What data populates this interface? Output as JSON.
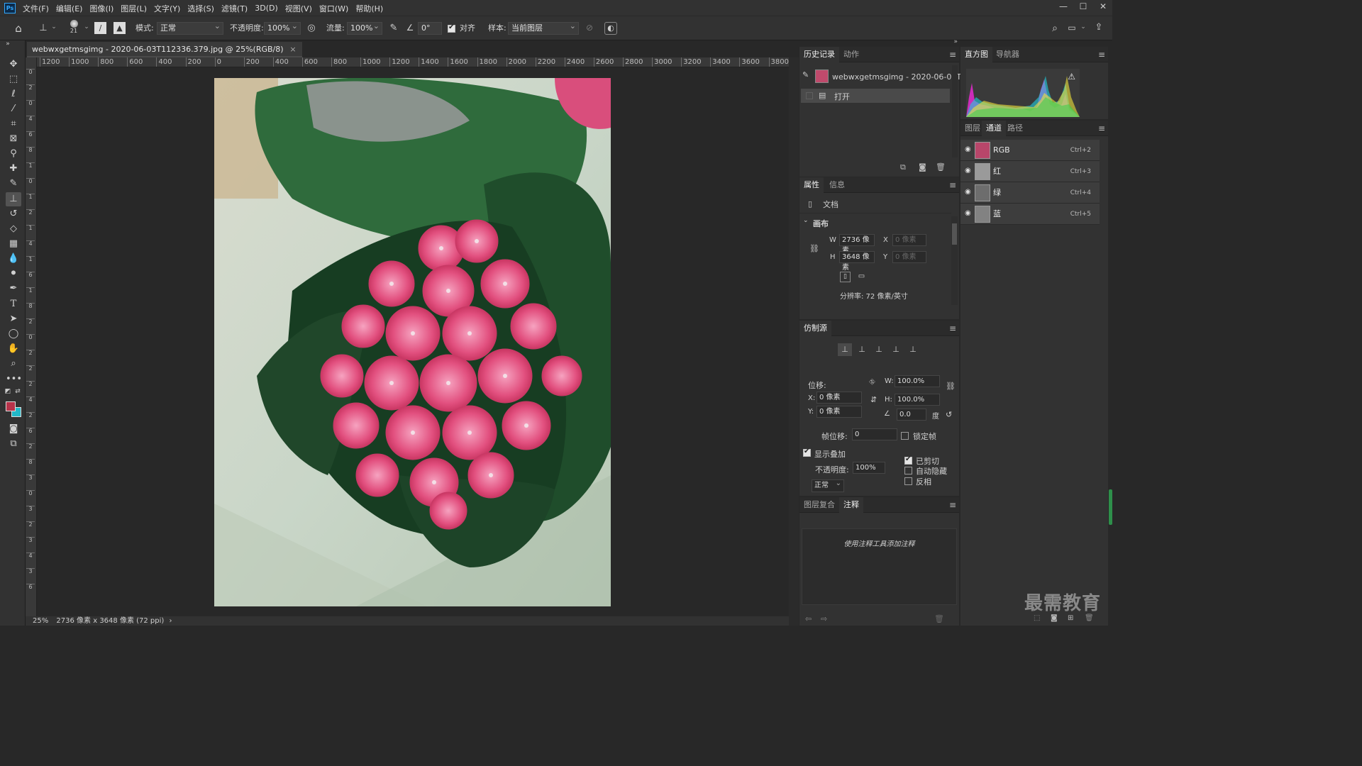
{
  "app": {
    "logo": "Ps"
  },
  "menu": [
    "文件(F)",
    "编辑(E)",
    "图像(I)",
    "图层(L)",
    "文字(Y)",
    "选择(S)",
    "滤镜(T)",
    "3D(D)",
    "视图(V)",
    "窗口(W)",
    "帮助(H)"
  ],
  "window_controls": {
    "minimize": "—",
    "maximize": "☐",
    "close": "✕"
  },
  "options": {
    "brush_size": "21",
    "mode_label": "模式:",
    "mode_value": "正常",
    "opacity_label": "不透明度:",
    "opacity_value": "100%",
    "flow_label": "流量:",
    "flow_value": "100%",
    "angle_value": "0°",
    "aligned_label": "对齐",
    "sample_label": "样本:",
    "sample_value": "当前图层"
  },
  "document": {
    "tab_title": "webwxgetmsgimg - 2020-06-03T112336.379.jpg @ 25%(RGB/8)",
    "tab_close": "×"
  },
  "ruler_h": [
    "1200",
    "1000",
    "800",
    "600",
    "400",
    "200",
    "0",
    "200",
    "400",
    "600",
    "800",
    "1000",
    "1200",
    "1400",
    "1600",
    "1800",
    "2000",
    "2200",
    "2400",
    "2600",
    "2800",
    "3000",
    "3200",
    "3400",
    "3600",
    "3800"
  ],
  "ruler_v": [
    "0",
    "2",
    "0",
    "4",
    "6",
    "8",
    "1",
    "0",
    "1",
    "2",
    "1",
    "4",
    "1",
    "6",
    "1",
    "8",
    "2",
    "0",
    "2",
    "2",
    "2",
    "4",
    "2",
    "6",
    "2",
    "8",
    "3",
    "0",
    "3",
    "2",
    "3",
    "4",
    "3",
    "6"
  ],
  "status": {
    "zoom": "25%",
    "info": "2736 像素 x 3648 像素 (72 ppi)",
    "arrow": "›"
  },
  "history": {
    "tab_active": "历史记录",
    "tab_other": "动作",
    "snapshot": "webwxgetmsgimg - 2020-06-03T...",
    "steps": [
      "打开"
    ]
  },
  "properties": {
    "tab_active": "属性",
    "tab_other": "信息",
    "doc_label": "文档",
    "section": "画布",
    "w_label": "W",
    "w_value": "2736 像素",
    "h_label": "H",
    "h_value": "3648 像素",
    "x_label": "X",
    "x_value": "0 像素",
    "y_label": "Y",
    "y_value": "0 像素",
    "resolution": "分辨率: 72 像素/英寸"
  },
  "clone_source": {
    "tab": "仿制源",
    "offset_label": "位移:",
    "x_label": "X:",
    "x_value": "0 像素",
    "y_label": "Y:",
    "y_value": "0 像素",
    "w_label": "W:",
    "w_value": "100.0%",
    "h_label": "H:",
    "h_value": "100.0%",
    "angle_value": "0.0",
    "angle_unit": "度",
    "frame_offset_label": "帧位移:",
    "frame_offset_value": "0",
    "lock_frame_label": "锁定帧",
    "show_overlay_label": "显示叠加",
    "opacity_label": "不透明度:",
    "opacity_value": "100%",
    "blend_value": "正常",
    "clipped_label": "已剪切",
    "auto_hide_label": "自动隐藏",
    "invert_label": "反相"
  },
  "notes": {
    "tab_other": "图层复合",
    "tab_active": "注释",
    "hint": "使用注释工具添加注释"
  },
  "histogram": {
    "tab_active": "直方图",
    "tab_other": "导航器",
    "warning": "⚠"
  },
  "channels": {
    "tabs": [
      "图层",
      "通道",
      "路径"
    ],
    "rows": [
      {
        "name": "RGB",
        "shortcut": "Ctrl+2"
      },
      {
        "name": "红",
        "shortcut": "Ctrl+3"
      },
      {
        "name": "绿",
        "shortcut": "Ctrl+4"
      },
      {
        "name": "蓝",
        "shortcut": "Ctrl+5"
      }
    ]
  },
  "watermark": "最需教育",
  "colors": {
    "foreground": "#b7334a",
    "background": "#22b8c8",
    "accent": "#31a8ff"
  }
}
